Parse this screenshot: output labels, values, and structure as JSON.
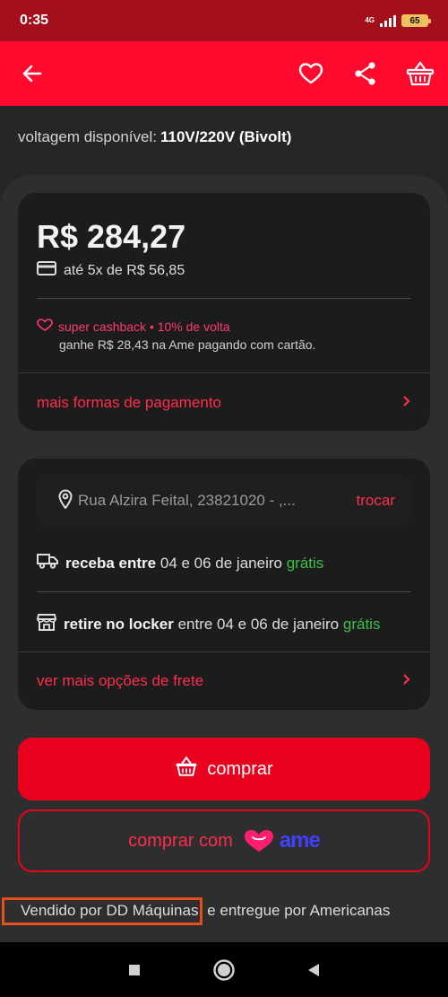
{
  "status_bar": {
    "time": "0:35",
    "network": "4G",
    "battery": "65"
  },
  "product": {
    "voltage_label": "voltagem disponível:",
    "voltage_value": "110V/220V (Bivolt)"
  },
  "price_card": {
    "price": "R$ 284,27",
    "installments": "até 5x de R$ 56,85",
    "cashback_title": "super cashback • 10% de volta",
    "cashback_text": "ganhe R$ 28,43 na Ame pagando com cartão.",
    "more_payment_link": "mais formas de pagamento"
  },
  "shipping_card": {
    "address": "Rua Alzira Feital, 23821020 - ,...",
    "change_label": "trocar",
    "delivery_bold": "receba entre",
    "delivery_dates": "04 e 06 de janeiro",
    "delivery_price": "grátis",
    "locker_bold": "retire no locker",
    "locker_dates": "entre 04 e 06 de janeiro",
    "locker_price": "grátis",
    "more_shipping_link": "ver mais opções de frete"
  },
  "actions": {
    "buy_label": "comprar",
    "buy_with_label": "comprar com",
    "ame_brand": "ame"
  },
  "seller": {
    "seller_name": "Vendido por DD Máquinas",
    "seller_rest": "e entregue por Americanas"
  },
  "colors": {
    "brand_red": "#ff0a2e",
    "status_red": "#a3101b",
    "accent_link": "#ff2d4d",
    "free_green": "#3dbf4a",
    "ame_blue": "#4040ff",
    "highlight_orange": "#e84e1b"
  },
  "icons": {
    "back": "arrow-left-icon",
    "favorite": "heart-icon",
    "share": "share-icon",
    "cart": "basket-icon",
    "card": "credit-card-icon",
    "cashback": "heart-outline-icon",
    "location": "location-pin-icon",
    "truck": "truck-icon",
    "locker": "store-icon",
    "chevron": "chevron-right-icon"
  }
}
